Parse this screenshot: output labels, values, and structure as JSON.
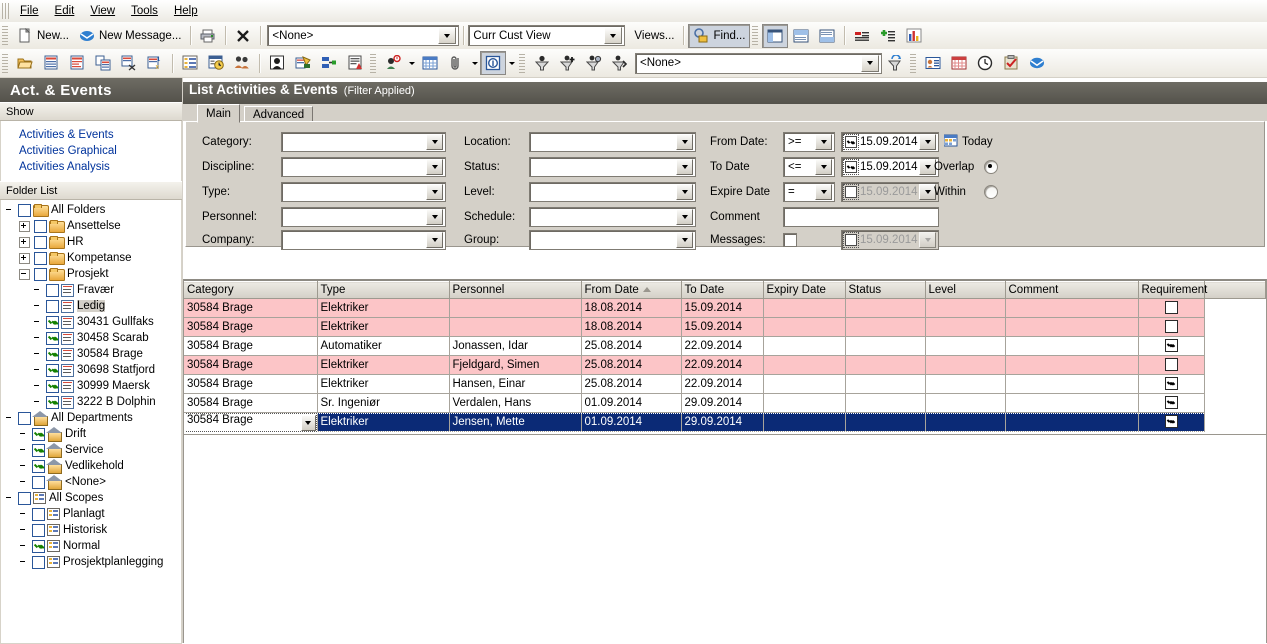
{
  "window": {
    "title": "List Activities & Events"
  },
  "menu": {
    "items": [
      "File",
      "Edit",
      "View",
      "Tools",
      "Help"
    ]
  },
  "toolbar1": {
    "new_label": "New...",
    "new_message_label": "New Message...",
    "print_icon": "printer-icon",
    "delete_icon": "delete-x-icon",
    "folder_combo_value": "<None>",
    "view_combo_value": "Curr Cust View",
    "views_label": "Views...",
    "find_label": "Find...",
    "icons": [
      "print-icon",
      "delete-icon",
      "layout-left-icon",
      "layout-top-icon",
      "layout-bottom-icon",
      "list-small-icon",
      "list-add-icon",
      "chart-icon"
    ]
  },
  "toolbar2": {
    "filter_combo_value": "<None>",
    "icons": [
      "open-folder-icon",
      "new-activity-icon",
      "edit-activity-icon",
      "copy-activity-icon",
      "cut-activity-icon",
      "renumber-activity-icon",
      "list-icon",
      "schedule-icon",
      "personnel-group-icon",
      "person-icon",
      "assign-icon",
      "link-icon",
      "report-icon",
      "person-alert-icon",
      "calendar-grid-icon",
      "attachment-icon",
      "info-icon",
      "filter-down-icon",
      "filter-add-icon",
      "filter-edit-icon",
      "filter-apply-icon",
      "filter-refresh-icon",
      "contact-card-icon",
      "calendar-icon",
      "clock-icon",
      "task-icon",
      "mail-icon"
    ]
  },
  "sidebar": {
    "title": "Act. & Events",
    "show_header": "Show",
    "links": [
      "Activities & Events",
      "Activities Graphical",
      "Activities Analysis"
    ],
    "folder_header": "Folder List",
    "tree": [
      {
        "label": "All Folders",
        "icon": "folder-icon",
        "indent": 0,
        "expander": "none",
        "checked": false
      },
      {
        "label": "Ansettelse",
        "icon": "folder-icon",
        "indent": 1,
        "expander": "plus",
        "checked": false
      },
      {
        "label": "HR",
        "icon": "folder-icon",
        "indent": 1,
        "expander": "plus",
        "checked": false
      },
      {
        "label": "Kompetanse",
        "icon": "folder-icon",
        "indent": 1,
        "expander": "plus",
        "checked": false
      },
      {
        "label": "Prosjekt",
        "icon": "folder-icon",
        "indent": 1,
        "expander": "minus",
        "checked": false
      },
      {
        "label": "Fravær",
        "icon": "document-icon",
        "indent": 2,
        "expander": "none",
        "checked": false
      },
      {
        "label": "Ledig",
        "icon": "document-icon",
        "indent": 2,
        "expander": "none",
        "checked": false,
        "selected": true
      },
      {
        "label": "30431 Gullfaks",
        "icon": "document-icon",
        "indent": 2,
        "expander": "none",
        "checked": true
      },
      {
        "label": "30458 Scarab",
        "icon": "document-icon",
        "indent": 2,
        "expander": "none",
        "checked": true
      },
      {
        "label": "30584 Brage",
        "icon": "document-icon",
        "indent": 2,
        "expander": "none",
        "checked": true
      },
      {
        "label": "30698 Statfjord",
        "icon": "document-icon",
        "indent": 2,
        "expander": "none",
        "checked": true
      },
      {
        "label": "30999 Maersk",
        "icon": "document-icon",
        "indent": 2,
        "expander": "none",
        "checked": true
      },
      {
        "label": "3222 B Dolphin",
        "icon": "document-icon",
        "indent": 2,
        "expander": "none",
        "checked": true
      },
      {
        "label": "All Departments",
        "icon": "house-icon",
        "indent": 0,
        "expander": "none",
        "checked": false
      },
      {
        "label": "Drift",
        "icon": "house-icon",
        "indent": 1,
        "expander": "none",
        "checked": true
      },
      {
        "label": "Service",
        "icon": "house-icon",
        "indent": 1,
        "expander": "none",
        "checked": true
      },
      {
        "label": "Vedlikehold",
        "icon": "house-icon",
        "indent": 1,
        "expander": "none",
        "checked": true
      },
      {
        "label": "<None>",
        "icon": "house-icon",
        "indent": 1,
        "expander": "none",
        "checked": false
      },
      {
        "label": "All Scopes",
        "icon": "scope-icon",
        "indent": 0,
        "expander": "none",
        "checked": false
      },
      {
        "label": "Planlagt",
        "icon": "scope-icon",
        "indent": 1,
        "expander": "none",
        "checked": false
      },
      {
        "label": "Historisk",
        "icon": "scope-icon",
        "indent": 1,
        "expander": "none",
        "checked": false
      },
      {
        "label": "Normal",
        "icon": "scope-icon",
        "indent": 1,
        "expander": "none",
        "checked": true
      },
      {
        "label": "Prosjektplanlegging",
        "icon": "scope-icon",
        "indent": 1,
        "expander": "none",
        "checked": false
      }
    ]
  },
  "main": {
    "title": "List Activities & Events",
    "title_suffix": "(Filter Applied)",
    "tabs": [
      {
        "label": "Main",
        "active": true
      },
      {
        "label": "Advanced",
        "active": false
      }
    ],
    "filter": {
      "col1": [
        {
          "label": "Category:",
          "value": ""
        },
        {
          "label": "Discipline:",
          "value": ""
        },
        {
          "label": "Type:",
          "value": ""
        },
        {
          "label": "Personnel:",
          "value": ""
        },
        {
          "label": "Company:",
          "value": ""
        }
      ],
      "col2": [
        {
          "label": "Location:",
          "value": ""
        },
        {
          "label": "Status:",
          "value": ""
        },
        {
          "label": "Level:",
          "value": ""
        },
        {
          "label": "Schedule:",
          "value": ""
        },
        {
          "label": "Group:",
          "value": ""
        }
      ],
      "from_date": {
        "label": "From Date:",
        "operator": ">=",
        "value": "15.09.2014",
        "checked": true,
        "enabled": true
      },
      "to_date": {
        "label": "To Date",
        "operator": "<=",
        "value": "15.09.2014",
        "checked": true,
        "enabled": true
      },
      "expire_date": {
        "label": "Expire Date",
        "operator": "=",
        "value": "15.09.2014",
        "checked": false,
        "enabled": false
      },
      "comment": {
        "label": "Comment",
        "value": ""
      },
      "messages": {
        "label": "Messages:",
        "checked": false,
        "date_value": "15.09.2014",
        "date_checked": false,
        "enabled": false
      },
      "today_label": "Today",
      "overlap_label": "Overlap",
      "within_label": "Within",
      "range_mode": "Overlap"
    },
    "grid": {
      "columns": [
        "Category",
        "Type",
        "Personnel",
        "From Date",
        "To Date",
        "Expiry Date",
        "Status",
        "Level",
        "Comment",
        "Requirement"
      ],
      "sorted_column": "From Date",
      "sort_direction": "asc",
      "rows": [
        {
          "Category": "30584 Brage",
          "Type": "Elektriker",
          "Personnel": "",
          "From Date": "18.08.2014",
          "To Date": "15.09.2014",
          "Expiry Date": "",
          "Status": "",
          "Level": "",
          "Comment": "",
          "Requirement": false,
          "style": "pink"
        },
        {
          "Category": "30584 Brage",
          "Type": "Elektriker",
          "Personnel": "",
          "From Date": "18.08.2014",
          "To Date": "15.09.2014",
          "Expiry Date": "",
          "Status": "",
          "Level": "",
          "Comment": "",
          "Requirement": false,
          "style": "pink"
        },
        {
          "Category": "30584 Brage",
          "Type": "Automatiker",
          "Personnel": "Jonassen, Idar",
          "From Date": "25.08.2014",
          "To Date": "22.09.2014",
          "Expiry Date": "",
          "Status": "",
          "Level": "",
          "Comment": "",
          "Requirement": true,
          "style": "white"
        },
        {
          "Category": "30584 Brage",
          "Type": "Elektriker",
          "Personnel": "Fjeldgard, Simen",
          "From Date": "25.08.2014",
          "To Date": "22.09.2014",
          "Expiry Date": "",
          "Status": "",
          "Level": "",
          "Comment": "",
          "Requirement": false,
          "style": "pink"
        },
        {
          "Category": "30584 Brage",
          "Type": "Elektriker",
          "Personnel": "Hansen, Einar",
          "From Date": "25.08.2014",
          "To Date": "22.09.2014",
          "Expiry Date": "",
          "Status": "",
          "Level": "",
          "Comment": "",
          "Requirement": true,
          "style": "white"
        },
        {
          "Category": "30584 Brage",
          "Type": "Sr. Ingeniør",
          "Personnel": "Verdalen, Hans",
          "From Date": "01.09.2014",
          "To Date": "29.09.2014",
          "Expiry Date": "",
          "Status": "",
          "Level": "",
          "Comment": "",
          "Requirement": true,
          "style": "white"
        },
        {
          "Category": "30584 Brage",
          "Type": "Elektriker",
          "Personnel": "Jensen, Mette",
          "From Date": "01.09.2014",
          "To Date": "29.09.2014",
          "Expiry Date": "",
          "Status": "",
          "Level": "",
          "Comment": "",
          "Requirement": true,
          "style": "sel",
          "editing": true
        }
      ]
    }
  },
  "colors": {
    "title_bar": "#5b5951",
    "highlight_row": "#0b2a76",
    "conflict_row": "#fcc5c7",
    "panel": "#d4d0c8",
    "link": "#00339c"
  }
}
